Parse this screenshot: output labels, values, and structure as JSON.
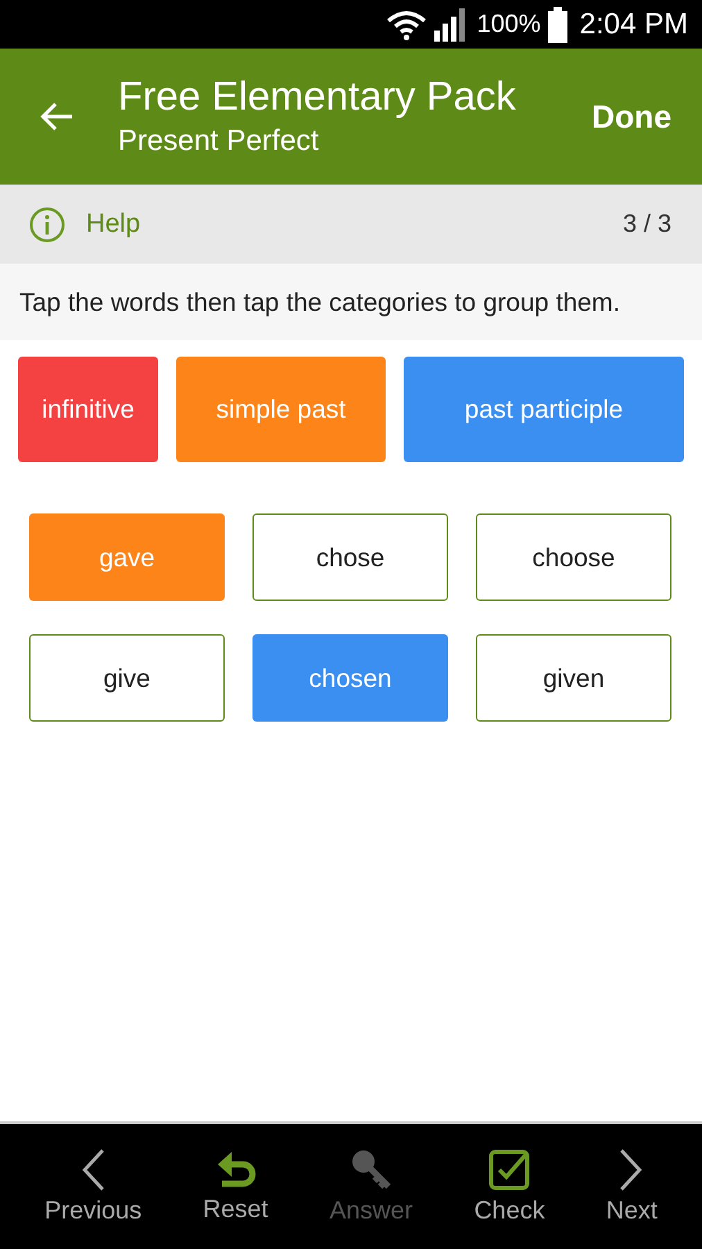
{
  "status_bar": {
    "battery": "100%",
    "time": "2:04 PM"
  },
  "app_bar": {
    "title": "Free Elementary Pack",
    "subtitle": "Present Perfect",
    "action": "Done"
  },
  "help_bar": {
    "label": "Help",
    "progress": "3 / 3"
  },
  "instruction": "Tap the words then tap the categories to group them.",
  "categories": [
    {
      "label": "infinitive",
      "color": "#f44141"
    },
    {
      "label": "simple past",
      "color": "#fd8419"
    },
    {
      "label": "past participle",
      "color": "#3b8ff0"
    }
  ],
  "words": [
    {
      "label": "gave",
      "color": "#fd8419"
    },
    {
      "label": "chose"
    },
    {
      "label": "choose"
    },
    {
      "label": "give"
    },
    {
      "label": "chosen",
      "color": "#3b8ff0"
    },
    {
      "label": "given"
    }
  ],
  "bottom_nav": [
    {
      "kind": "previous",
      "label": "Previous",
      "disabled": false
    },
    {
      "kind": "reset",
      "label": "Reset",
      "disabled": false
    },
    {
      "kind": "answer",
      "label": "Answer",
      "disabled": true
    },
    {
      "kind": "check",
      "label": "Check",
      "disabled": false
    },
    {
      "kind": "next",
      "label": "Next",
      "disabled": false
    }
  ]
}
